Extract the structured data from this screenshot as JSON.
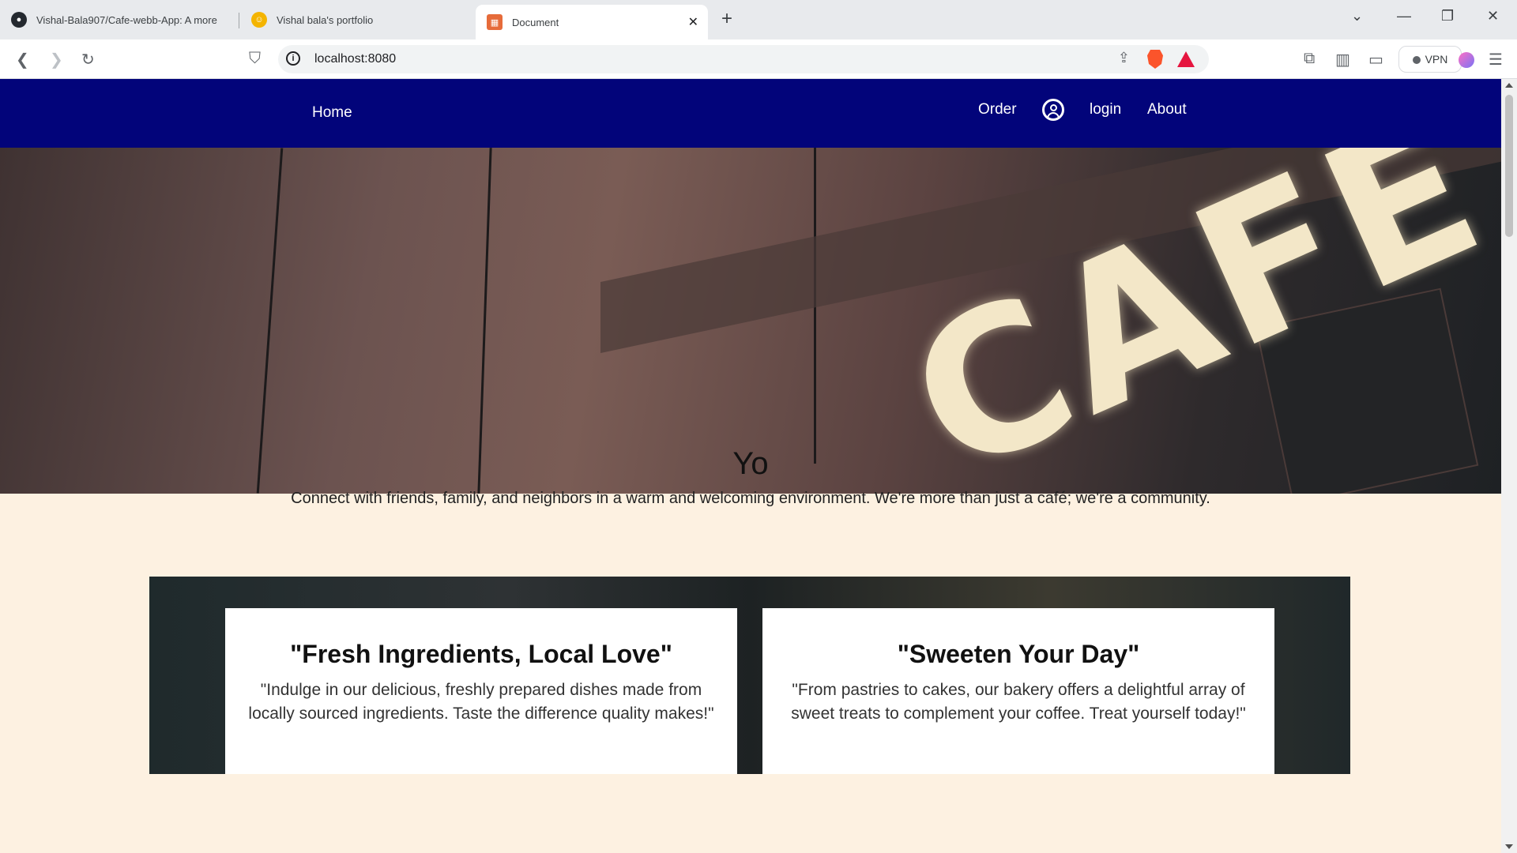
{
  "browser": {
    "tabs": [
      {
        "title": "Vishal-Bala907/Cafe-webb-App: A more",
        "icon": "github-icon"
      },
      {
        "title": "Vishal bala's portfolio",
        "icon": "portfolio-icon"
      },
      {
        "title": "Document",
        "icon": "document-icon"
      }
    ],
    "url": "localhost:8080",
    "vpn_label": "VPN"
  },
  "nav": {
    "home": "Home",
    "order": "Order",
    "login": "login",
    "about": "About"
  },
  "hero": {
    "sign_text": "CAFE"
  },
  "intro": {
    "title": "Yo",
    "text": "Connect with friends, family, and neighbors in a warm and welcoming environment. We're more than just a café; we're a community."
  },
  "features": [
    {
      "title": "\"Fresh Ingredients, Local Love\"",
      "text": "\"Indulge in our delicious, freshly prepared dishes made from locally sourced ingredients. Taste the difference quality makes!\""
    },
    {
      "title": "\"Sweeten Your Day\"",
      "text": "\"From pastries to cakes, our bakery offers a delightful array of sweet treats to complement your coffee. Treat yourself today!\""
    }
  ],
  "colors": {
    "nav_bg": "#02047a",
    "page_bg": "#fdf1e1"
  }
}
